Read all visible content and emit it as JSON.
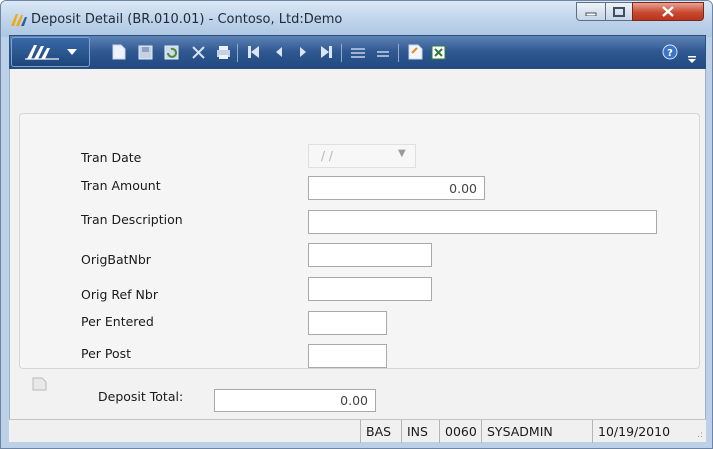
{
  "window": {
    "title": "Deposit Detail (BR.010.01) - Contoso, Ltd:Demo"
  },
  "window_buttons": [
    "minimize-icon",
    "maximize-icon",
    "close-icon"
  ],
  "toolbar": {
    "icons": [
      "new-icon",
      "save-icon",
      "refresh-icon",
      "delete-icon",
      "print-icon",
      "first-icon",
      "previous-icon",
      "next-icon",
      "last-icon",
      "insert-line-icon",
      "delete-line-icon",
      "notes-icon",
      "export-icon",
      "help-icon"
    ]
  },
  "form": {
    "tran_date": {
      "label": "Tran Date",
      "value": "/ /"
    },
    "tran_amount": {
      "label": "Tran Amount",
      "value": "0.00"
    },
    "tran_description": {
      "label": "Tran Description",
      "value": ""
    },
    "orig_bat_nbr": {
      "label": "OrigBatNbr",
      "value": ""
    },
    "orig_ref_nbr": {
      "label": "Orig Ref Nbr",
      "value": ""
    },
    "per_entered": {
      "label": "Per Entered",
      "value": ""
    },
    "per_post": {
      "label": "Per Post",
      "value": ""
    }
  },
  "footer": {
    "deposit_total_label": "Deposit Total:",
    "deposit_total_value": "0.00"
  },
  "status_bar": {
    "mode": "BAS",
    "insert": "INS",
    "company": "0060",
    "user": "SYSADMIN",
    "date": "10/19/2010"
  },
  "colors": {
    "toolbar_bg": "#2f5790",
    "close_button": "#c94a31",
    "title_bar": "#bed3ea"
  }
}
